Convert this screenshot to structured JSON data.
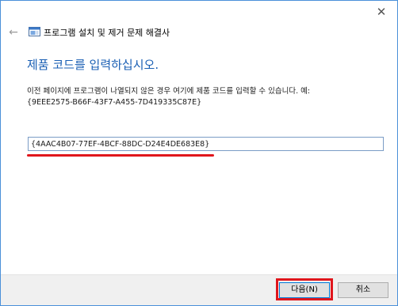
{
  "window": {
    "close_glyph": "✕"
  },
  "header": {
    "back_glyph": "←",
    "title": "프로그램 설치 및 제거 문제 해결사"
  },
  "main": {
    "heading": "제품 코드를 입력하십시오.",
    "description_line1": "이전 페이지에 프로그램이 나열되지 않은 경우 여기에 제품 코드를 입력할 수 있습니다. 예:",
    "description_line2": "{9EEE2575-B66F-43F7-A455-7D419335C87E}",
    "product_code_value": "{4AAC4B07-77EF-4BCF-88DC-D24E4DE683E8}"
  },
  "footer": {
    "next_label": "다음(N)",
    "cancel_label": "취소"
  },
  "colors": {
    "accent": "#1a5fb4",
    "highlight_red": "#e0161c"
  }
}
